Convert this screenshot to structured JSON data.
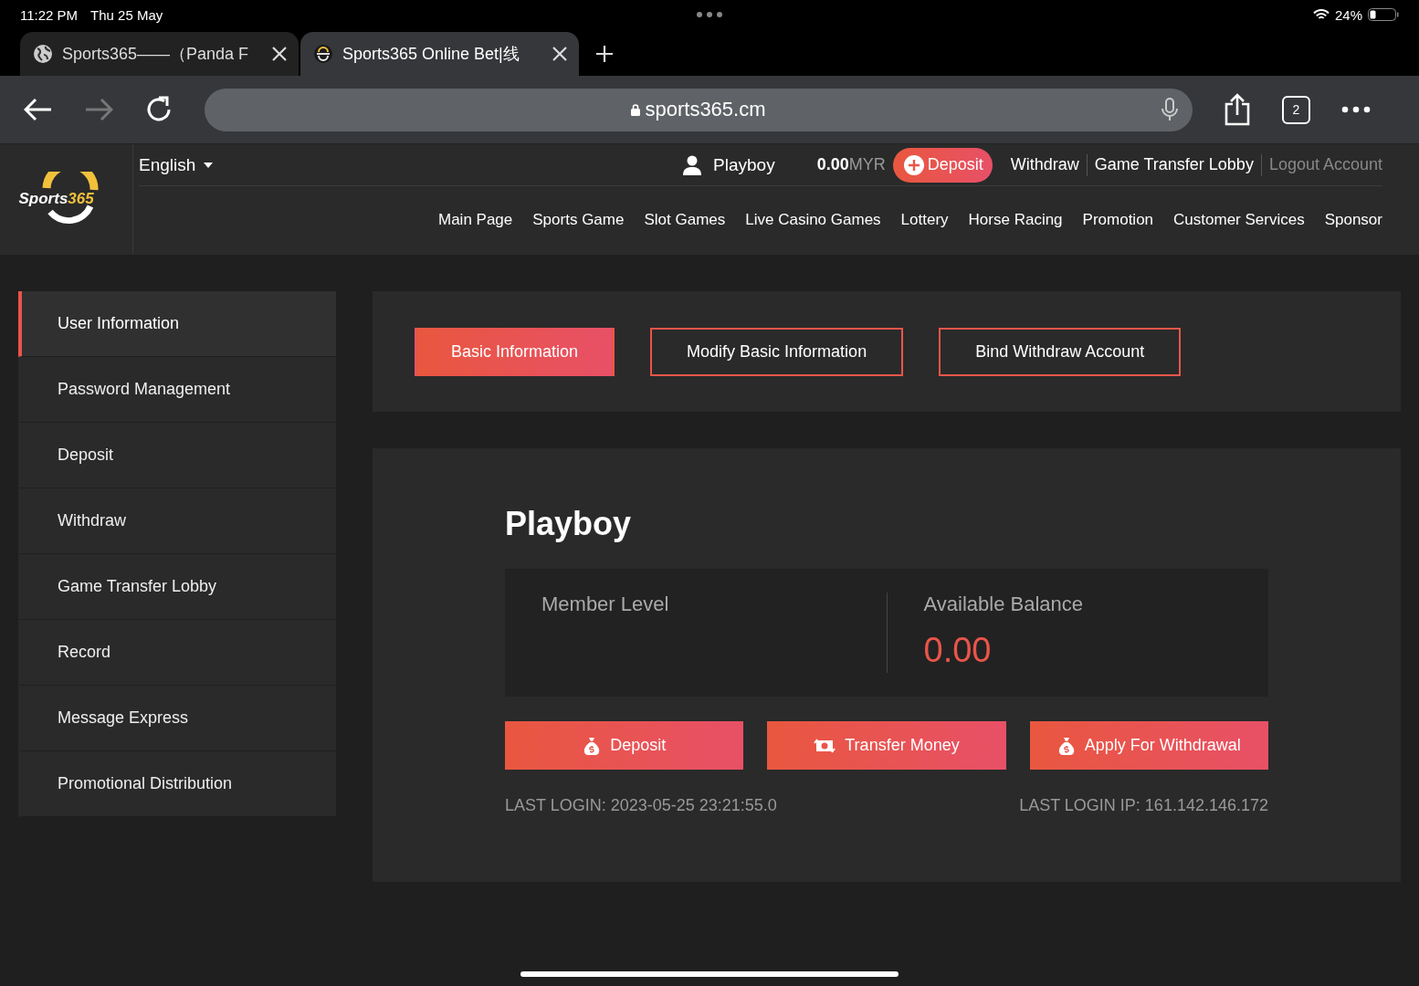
{
  "status_bar": {
    "time": "11:22 PM",
    "date": "Thu 25 May",
    "battery": "24%"
  },
  "browser_tabs": [
    {
      "title": "Sports365——（Panda F",
      "selected": false,
      "kind": "globe"
    },
    {
      "title": "Sports365 Online Bet|线",
      "selected": true,
      "kind": "site"
    }
  ],
  "toolbar": {
    "url": "sports365.cm",
    "tab_count": "2"
  },
  "site_header": {
    "logo": {
      "text": "Sports",
      "accent": "365"
    },
    "language": "English",
    "username": "Playboy",
    "balance": "0.00",
    "currency": "MYR",
    "deposit": "Deposit",
    "links": [
      {
        "label": "Withdraw",
        "disabled": false
      },
      {
        "label": "Game Transfer Lobby",
        "disabled": false
      },
      {
        "label": "Logout Account",
        "disabled": true
      }
    ],
    "nav": [
      "Main Page",
      "Sports Game",
      "Slot Games",
      "Live Casino Games",
      "Lottery",
      "Horse Racing",
      "Promotion",
      "Customer Services",
      "Sponsor"
    ]
  },
  "sidebar": {
    "items": [
      {
        "label": "User Information",
        "selected": true
      },
      {
        "label": "Password Management",
        "selected": false
      },
      {
        "label": "Deposit",
        "selected": false
      },
      {
        "label": "Withdraw",
        "selected": false
      },
      {
        "label": "Game Transfer Lobby",
        "selected": false
      },
      {
        "label": "Record",
        "selected": false
      },
      {
        "label": "Message Express",
        "selected": false
      },
      {
        "label": "Promotional Distribution",
        "selected": false
      }
    ]
  },
  "tabs": [
    {
      "label": "Basic Information",
      "selected": true
    },
    {
      "label": "Modify Basic Information",
      "selected": false
    },
    {
      "label": "Bind Withdraw Account",
      "selected": false
    }
  ],
  "profile": {
    "name": "Playboy",
    "member_level_label": "Member Level",
    "balance_label": "Available Balance",
    "balance": "0.00",
    "actions": [
      {
        "label": "Deposit",
        "kind": "bag"
      },
      {
        "label": "Transfer Money",
        "kind": "cash"
      },
      {
        "label": "Apply For Withdrawal",
        "kind": "bag"
      }
    ],
    "last_login": "LAST LOGIN: 2023-05-25 23:21:55.0",
    "last_login_ip": "LAST LOGIN IP: 161.142.146.172"
  }
}
